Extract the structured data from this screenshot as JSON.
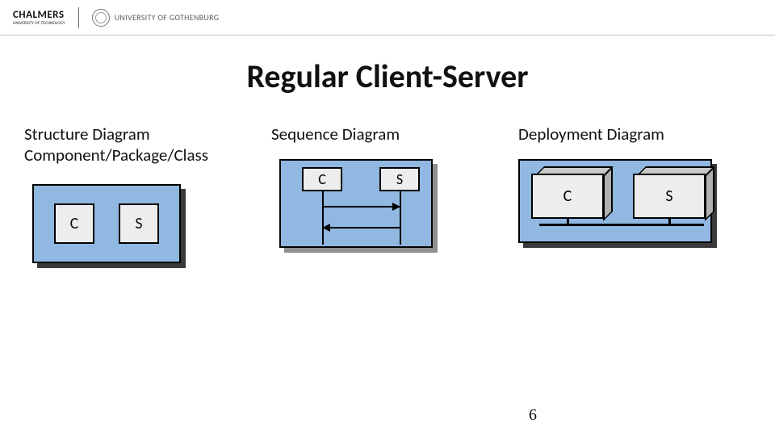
{
  "header": {
    "chalmers_word": "CHALMERS",
    "chalmers_sub": "UNIVERSITY OF TECHNOLOGY",
    "gu_text": "University of Gothenburg"
  },
  "title": "Regular Client-Server",
  "columns": {
    "structure": {
      "title_line1": "Structure Diagram",
      "title_line2": "Component/Package/Class"
    },
    "sequence": {
      "title": "Sequence Diagram"
    },
    "deployment": {
      "title": "Deployment Diagram"
    }
  },
  "labels": {
    "client": "C",
    "server": "S"
  },
  "page_number": "6",
  "chart_data": {
    "type": "diagram",
    "title": "Regular Client-Server",
    "panels": [
      {
        "name": "Structure Diagram",
        "subtitle": "Component/Package/Class",
        "kind": "component",
        "components": [
          "C",
          "S"
        ]
      },
      {
        "name": "Sequence Diagram",
        "kind": "sequence",
        "lifelines": [
          "C",
          "S"
        ],
        "messages": [
          {
            "from": "C",
            "to": "S"
          },
          {
            "from": "S",
            "to": "C"
          }
        ]
      },
      {
        "name": "Deployment Diagram",
        "kind": "deployment",
        "nodes": [
          "C",
          "S"
        ],
        "links": [
          [
            "C",
            "S"
          ]
        ]
      }
    ]
  }
}
